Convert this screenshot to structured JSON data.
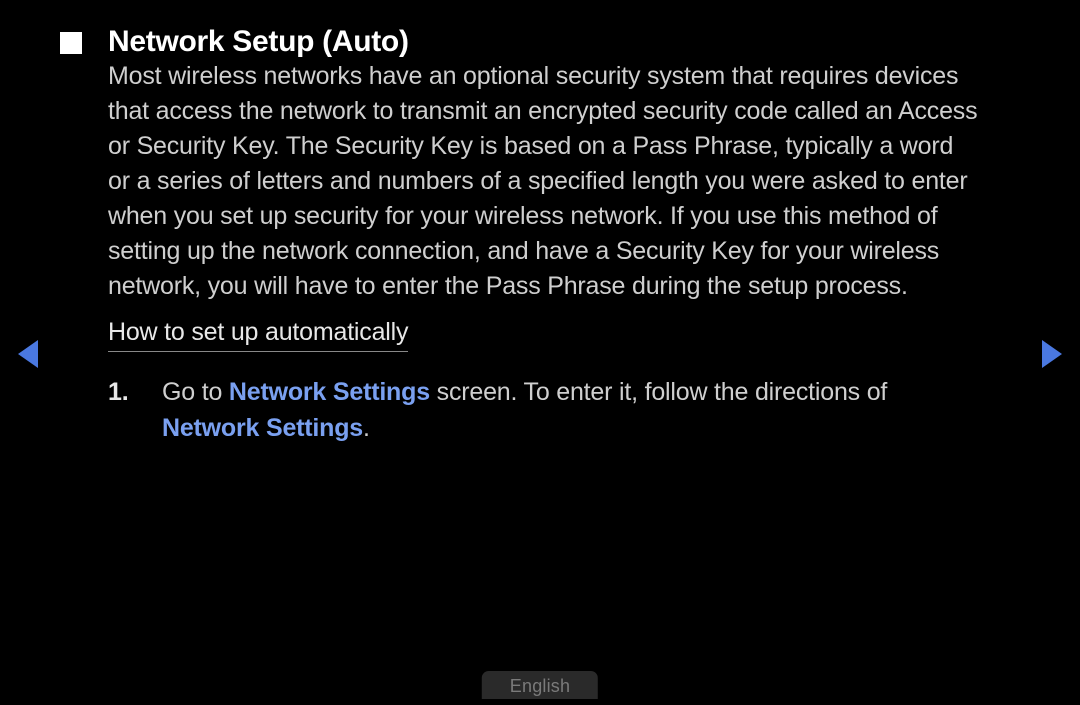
{
  "page": {
    "title": "Network Setup (Auto)",
    "body": "Most wireless networks have an optional security system that requires devices that access the network to transmit an encrypted security code called an Access or Security Key. The Security Key is based on a Pass Phrase, typically a word or a series of letters and numbers of a specified length you were asked to enter when you set up security for your wireless network. If you use this method of setting up the network connection, and have a Security Key for your wireless network, you will have to enter the Pass Phrase during the setup process.",
    "subheading": "How to set up automatically",
    "step1": {
      "num": "1.",
      "seg1": "Go to ",
      "link1": "Network Settings",
      "seg2": " screen. To enter it, follow the directions of ",
      "link2": "Network Settings",
      "seg3": "."
    }
  },
  "footer": {
    "language": "English"
  }
}
